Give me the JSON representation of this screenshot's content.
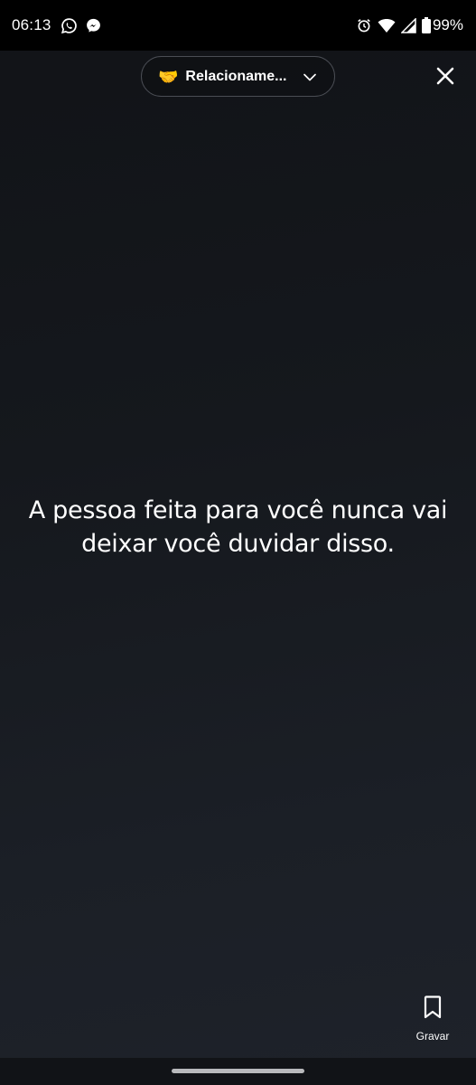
{
  "status_bar": {
    "time": "06:13",
    "left_icons": [
      "whatsapp-icon",
      "messenger-icon"
    ],
    "right_icons": [
      "alarm-icon",
      "wifi-icon",
      "signal-icon"
    ],
    "battery": "99%"
  },
  "header": {
    "category_emoji": "🤝",
    "category_label": "Relacioname...",
    "close_icon": "close-icon"
  },
  "quote": {
    "text": "A pessoa feita para você nunca vai deixar você duvidar disso."
  },
  "actions": {
    "save_label": "Gravar",
    "save_icon": "bookmark-icon"
  },
  "colors": {
    "background_top": "#111317",
    "background_bottom": "#1e222a",
    "text": "#ffffff",
    "pill_border": "#4a4d54"
  }
}
